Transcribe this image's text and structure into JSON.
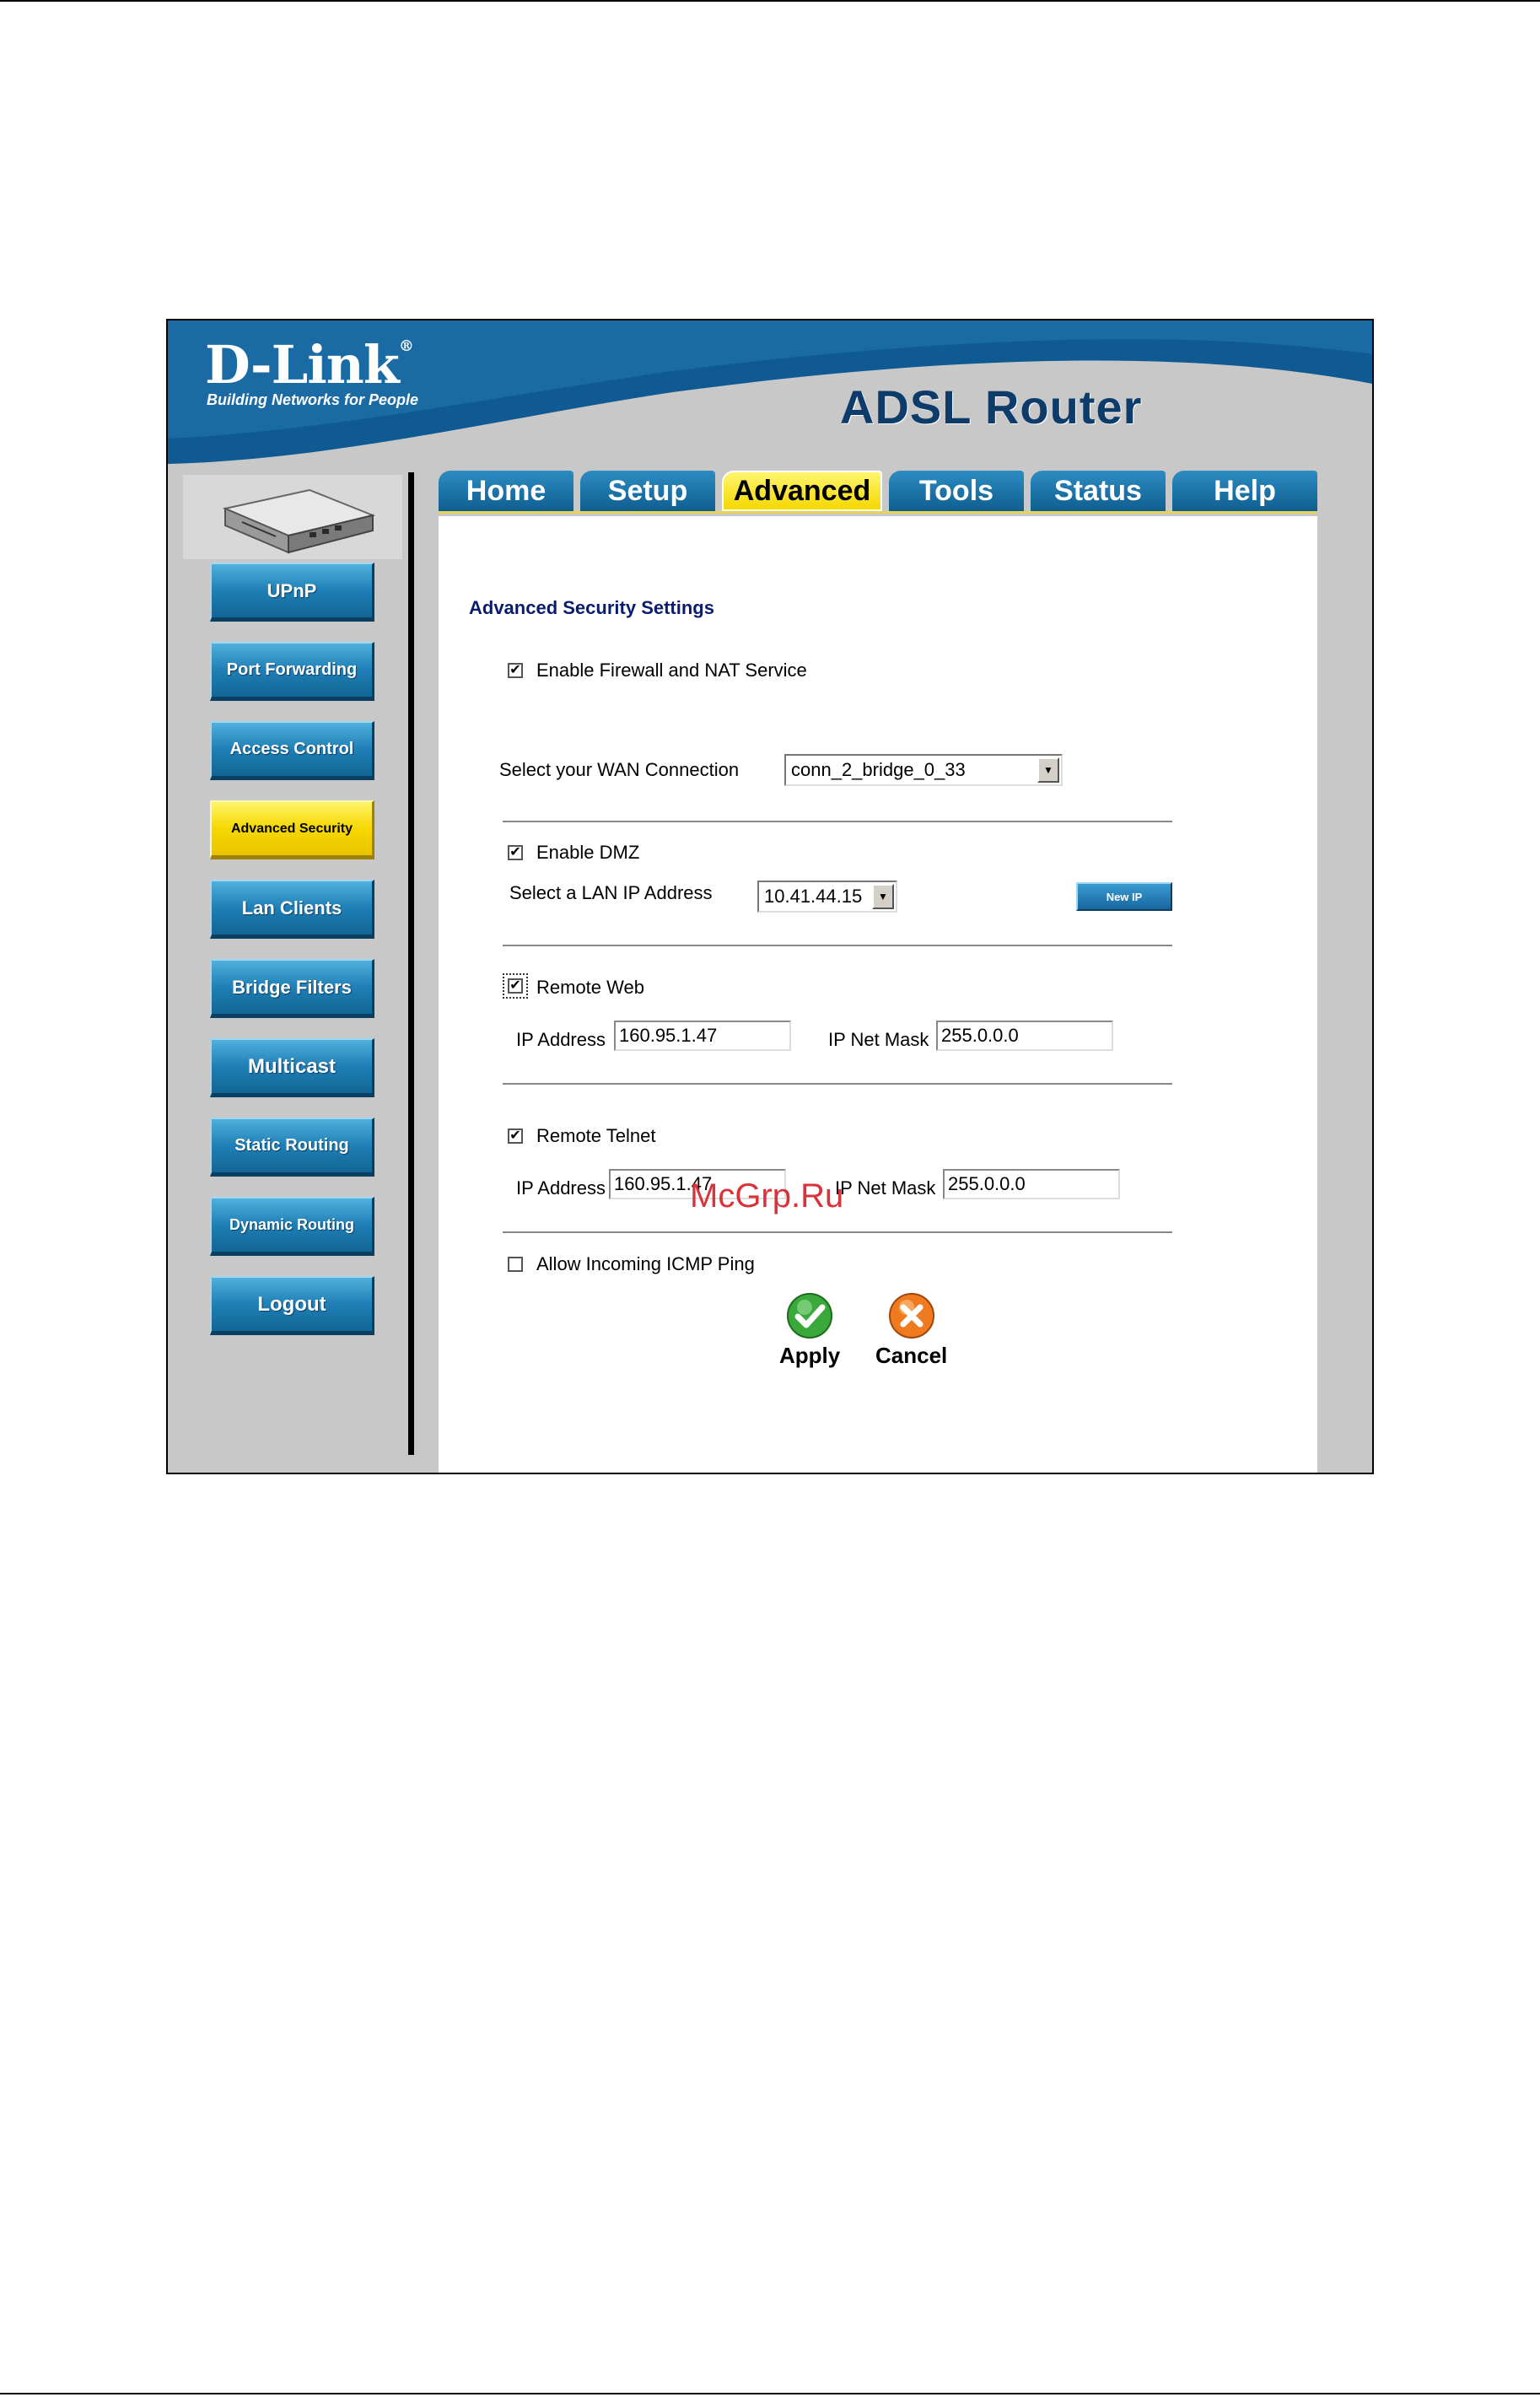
{
  "banner": {
    "logo": "D-Link",
    "tagline": "Building Networks for People",
    "product": "ADSL Router"
  },
  "sidebar": {
    "items": [
      {
        "label": "UPnP"
      },
      {
        "label": "Port Forwarding"
      },
      {
        "label": "Access Control"
      },
      {
        "label": "Advanced Security",
        "active": true
      },
      {
        "label": "Lan Clients"
      },
      {
        "label": "Bridge Filters"
      },
      {
        "label": "Multicast"
      },
      {
        "label": "Static Routing"
      },
      {
        "label": "Dynamic Routing"
      },
      {
        "label": "Logout"
      }
    ]
  },
  "tabs": [
    {
      "label": "Home"
    },
    {
      "label": "Setup"
    },
    {
      "label": "Advanced",
      "active": true
    },
    {
      "label": "Tools"
    },
    {
      "label": "Status"
    },
    {
      "label": "Help"
    }
  ],
  "main": {
    "title": "Advanced Security Settings",
    "firewall": {
      "label": "Enable Firewall and NAT Service",
      "checked": true
    },
    "wan": {
      "label": "Select your WAN Connection",
      "value": "conn_2_bridge_0_33"
    },
    "dmz": {
      "label": "Enable DMZ",
      "checked": true,
      "lan_label": "Select a LAN IP Address",
      "lan_value": "10.41.44.15",
      "new_ip": "New IP"
    },
    "remote_web": {
      "label": "Remote Web",
      "checked": true,
      "ip_label": "IP Address",
      "ip_value": "160.95.1.47",
      "mask_label": "IP Net Mask",
      "mask_value": "255.0.0.0"
    },
    "remote_telnet": {
      "label": "Remote Telnet",
      "checked": true,
      "ip_label": "IP Address",
      "ip_value": "160.95.1.47",
      "mask_label": "IP Net Mask",
      "mask_value": "255.0.0.0"
    },
    "icmp": {
      "label": "Allow Incoming ICMP Ping",
      "checked": false
    },
    "apply": "Apply",
    "cancel": "Cancel"
  },
  "watermark": "McGrp.Ru",
  "colors": {
    "brand_blue": "#0f5e90",
    "active_yellow": "#f4d800",
    "title_navy": "#0a1c6e"
  }
}
